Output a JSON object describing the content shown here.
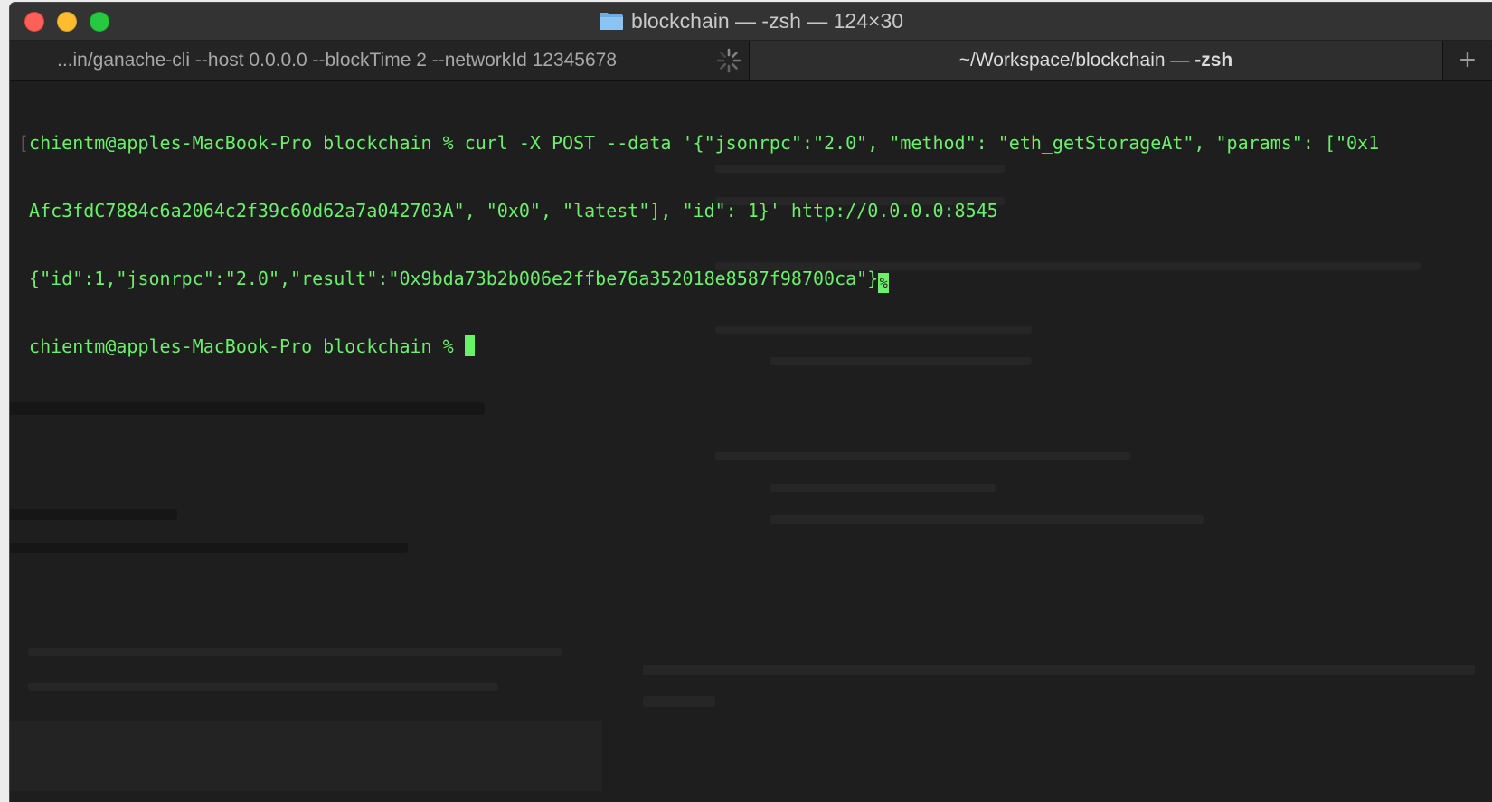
{
  "window": {
    "title": "blockchain — -zsh — 124×30"
  },
  "tabs": [
    {
      "label": "...in/ganache-cli --host 0.0.0.0 --blockTime 2 --networkId 12345678",
      "busy": true
    },
    {
      "label_prefix": "~/Workspace/blockchain — ",
      "label_bold": "-zsh",
      "active": true
    }
  ],
  "new_tab_symbol": "+",
  "terminal": {
    "text_color": "#6bf06b",
    "background": "#1e1e1e",
    "lines": [
      "chientm@apples-MacBook-Pro blockchain % curl -X POST --data '{\"jsonrpc\":\"2.0\", \"method\": \"eth_getStorageAt\", \"params\": [\"0x1",
      "Afc3fdC7884c6a2064c2f39c60d62a7a042703A\", \"0x0\", \"latest\"], \"id\": 1}' http://0.0.0.0:8545",
      "{\"id\":1,\"jsonrpc\":\"2.0\",\"result\":\"0x9bda73b2b006e2ffbe76a352018e8587f98700ca\"}",
      "chientm@apples-MacBook-Pro blockchain % "
    ],
    "line1_marker": "[",
    "eol_marker": "%"
  },
  "colors": {
    "close": "#fe5f57",
    "minimize": "#febc2e",
    "zoom": "#28c840",
    "folder": "#6aaee6"
  },
  "icons": [
    "folder-icon",
    "spinner-icon",
    "plus-icon"
  ]
}
